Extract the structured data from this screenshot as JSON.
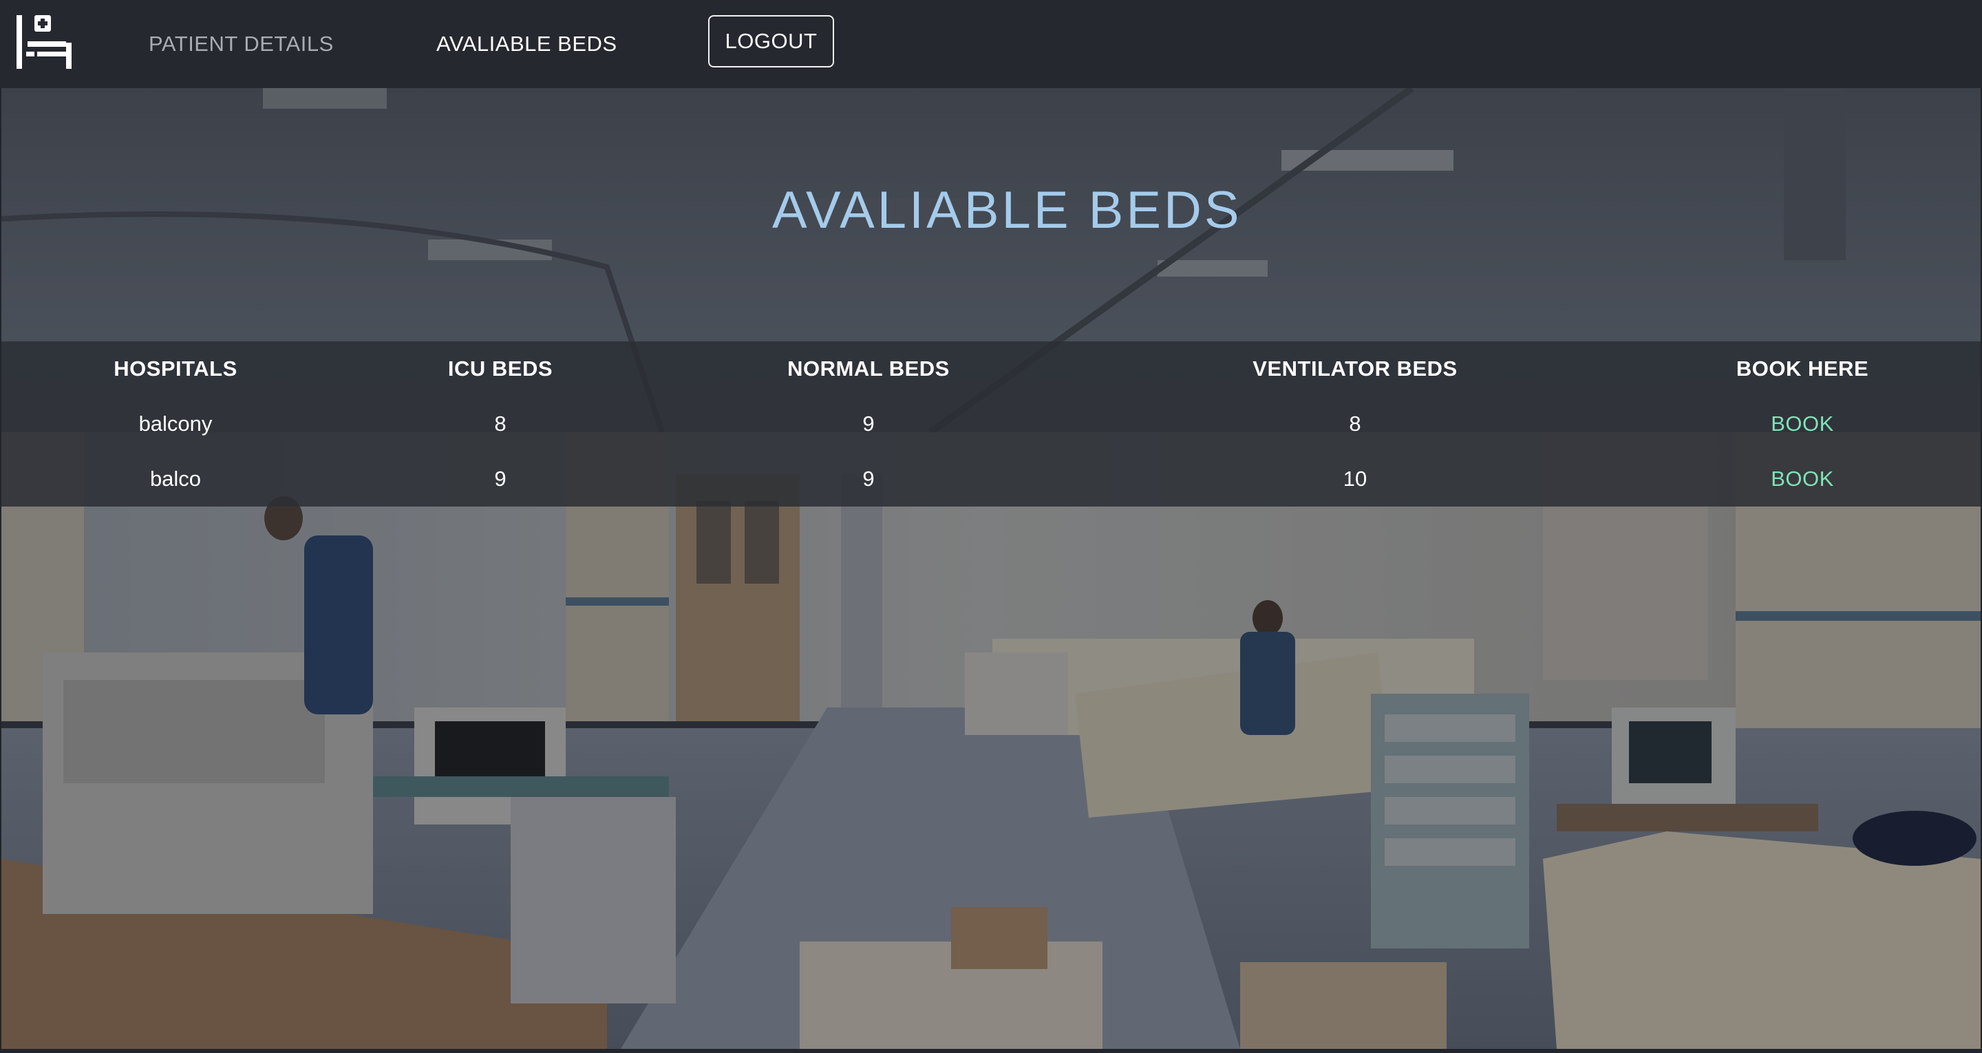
{
  "nav": {
    "patient_details": "PATIENT DETAILS",
    "available_beds": "AVALIABLE BEDS",
    "logout": "LOGOUT"
  },
  "page": {
    "title": "AVALIABLE BEDS"
  },
  "table": {
    "headers": {
      "hospitals": "HOSPITALS",
      "icu": "ICU BEDS",
      "normal": "NORMAL BEDS",
      "ventilator": "VENTILATOR BEDS",
      "book": "BOOK HERE"
    },
    "rows": [
      {
        "hospital": "balcony",
        "icu": "8",
        "normal": "9",
        "ventilator": "8",
        "book": "BOOK"
      },
      {
        "hospital": "balco",
        "icu": "9",
        "normal": "9",
        "ventilator": "10",
        "book": "BOOK"
      }
    ]
  },
  "icons": {
    "logo": "hospital-bed-icon"
  },
  "colors": {
    "navbar_bg": "#25282e",
    "title": "#a5cbeb",
    "book_link": "#7fe3b8",
    "table_band": "#2b2e34"
  }
}
